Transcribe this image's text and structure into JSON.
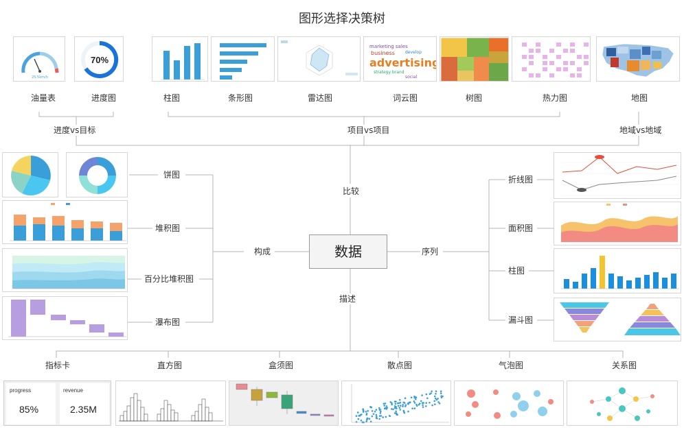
{
  "title": "图形选择决策树",
  "center": "数据",
  "branches": {
    "compare": "比较",
    "compose": "构成",
    "series": "序列",
    "describe": "描述"
  },
  "compare_groups": {
    "progress_vs_goal": "进度vs目标",
    "item_vs_item": "项目vs项目",
    "region_vs_region": "地域vs地域"
  },
  "top_items": [
    "油量表",
    "进度图",
    "柱图",
    "条形图",
    "雷达图",
    "词云图",
    "树图",
    "热力图",
    "地图"
  ],
  "compose_items": [
    "饼图",
    "堆积图",
    "百分比堆积图",
    "瀑布图"
  ],
  "series_items": [
    "折线图",
    "面积图",
    "柱图",
    "漏斗图"
  ],
  "describe_items": [
    "指标卡",
    "直方图",
    "盒须图",
    "散点图",
    "气泡图",
    "关系图"
  ],
  "thumb_text": {
    "progress_pct": "70%",
    "gauge_value": "25.5km/h",
    "wordcloud_big": "advertising",
    "wordcloud_small": "business",
    "kpi1_label": "progress",
    "kpi1_value": "85%",
    "kpi2_label": "revenue",
    "kpi2_value": "2.35M"
  },
  "colors": {
    "blue": "#3a9fd8",
    "gray_line": "#b5b5b5",
    "accent_orange": "#f5a26b"
  }
}
